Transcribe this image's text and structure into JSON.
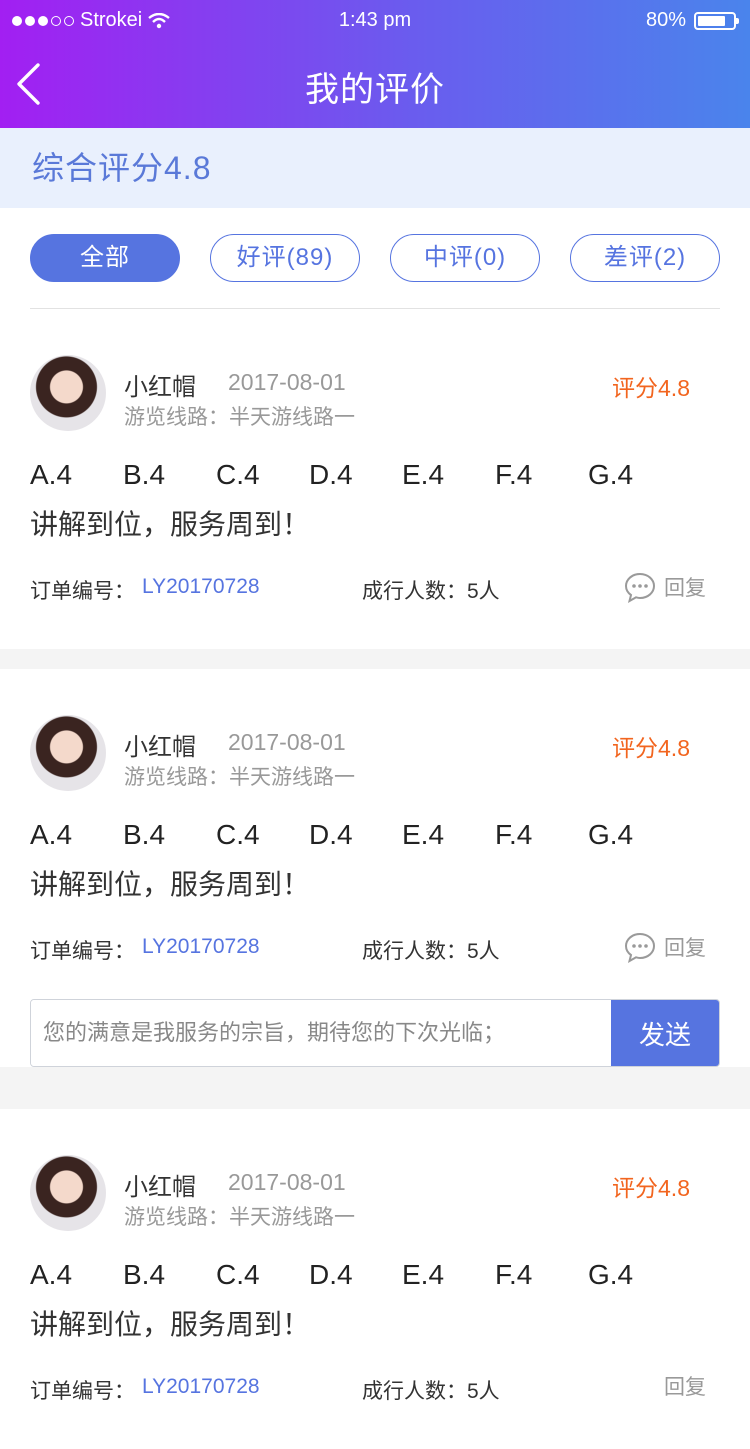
{
  "status": {
    "carrier": "Strokei",
    "time": "1:43 pm",
    "battery_text": "80%",
    "battery_level": 0.8
  },
  "nav": {
    "title": "我的评价"
  },
  "summary": {
    "text": "综合评分4.8"
  },
  "filters": [
    "全部",
    "好评(89)",
    "中评(0)",
    "差评(2)"
  ],
  "reviews": [
    {
      "name": "小红帽",
      "date": "2017-08-01",
      "route": "游览线路：半天游线路一",
      "score": "评分4.8",
      "grades": [
        "A.4",
        "B.4",
        "C.4",
        "D.4",
        "E.4",
        "F.4",
        "G.4"
      ],
      "text": "讲解到位，服务周到！",
      "order_label": "订单编号：",
      "order_no": "LY20170728",
      "people": "成行人数：5人",
      "reply": "回复"
    },
    {
      "name": "小红帽",
      "date": "2017-08-01",
      "route": "游览线路：半天游线路一",
      "score": "评分4.8",
      "grades": [
        "A.4",
        "B.4",
        "C.4",
        "D.4",
        "E.4",
        "F.4",
        "G.4"
      ],
      "text": "讲解到位，服务周到！",
      "order_label": "订单编号：",
      "order_no": "LY20170728",
      "people": "成行人数：5人",
      "reply": "回复"
    },
    {
      "name": "小红帽",
      "date": "2017-08-01",
      "route": "游览线路：半天游线路一",
      "score": "评分4.8",
      "grades": [
        "A.4",
        "B.4",
        "C.4",
        "D.4",
        "E.4",
        "F.4",
        "G.4"
      ],
      "text": "讲解到位，服务周到！",
      "order_label": "订单编号：",
      "order_no": "LY20170728",
      "people": "成行人数：5人",
      "reply": "回复"
    }
  ],
  "reply_box": {
    "placeholder": "您的满意是我服务的宗旨，期待您的下次光临；",
    "send_label": "发送"
  }
}
